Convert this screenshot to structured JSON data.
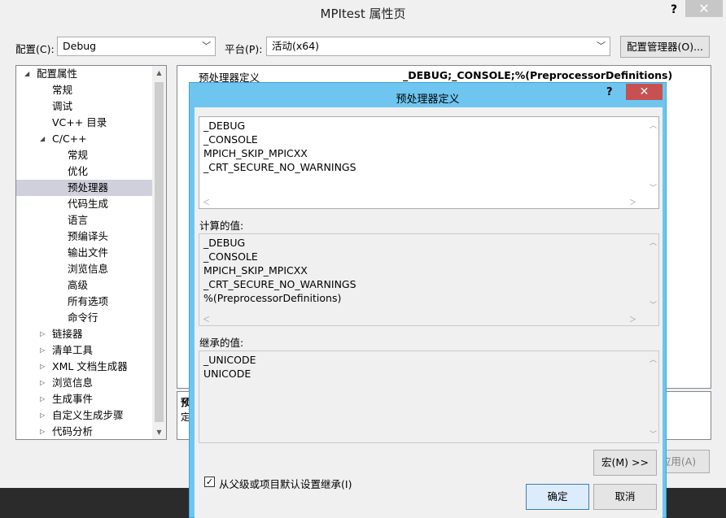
{
  "window": {
    "title": "MPItest 属性页",
    "help": "?",
    "close": "✕"
  },
  "toolbar": {
    "config_label": "配置(C):",
    "config_value": "Debug",
    "platform_label": "平台(P):",
    "platform_value": "活动(x64)",
    "config_manager": "配置管理器(O)..."
  },
  "tree": {
    "items": [
      {
        "label": "配置属性",
        "arrow": "◢"
      },
      {
        "label": "常规"
      },
      {
        "label": "调试"
      },
      {
        "label": "VC++ 目录"
      },
      {
        "label": "C/C++",
        "arrow": "◢"
      },
      {
        "label": "常规"
      },
      {
        "label": "优化"
      },
      {
        "label": "预处理器"
      },
      {
        "label": "代码生成"
      },
      {
        "label": "语言"
      },
      {
        "label": "预编译头"
      },
      {
        "label": "输出文件"
      },
      {
        "label": "浏览信息"
      },
      {
        "label": "高级"
      },
      {
        "label": "所有选项"
      },
      {
        "label": "命令行"
      },
      {
        "label": "链接器",
        "arrow": "▷"
      },
      {
        "label": "清单工具",
        "arrow": "▷"
      },
      {
        "label": "XML 文档生成器",
        "arrow": "▷"
      },
      {
        "label": "浏览信息",
        "arrow": "▷"
      },
      {
        "label": "生成事件",
        "arrow": "▷"
      },
      {
        "label": "自定义生成步骤",
        "arrow": "▷"
      },
      {
        "label": "代码分析",
        "arrow": "▷"
      }
    ]
  },
  "grid": {
    "row_name": "预处理器定义",
    "row_value": "_DEBUG;_CONSOLE;%(PreprocessorDefinitions)",
    "desc_title": "预",
    "desc_text": "定"
  },
  "apply_button": "应用(A)",
  "dialog": {
    "title": "预处理器定义",
    "help": "?",
    "close": "✕",
    "definitions": [
      "_DEBUG",
      "_CONSOLE",
      "MPICH_SKIP_MPICXX",
      "_CRT_SECURE_NO_WARNINGS"
    ],
    "evaluated_label": "计算的值:",
    "evaluated": [
      "_DEBUG",
      "_CONSOLE",
      "MPICH_SKIP_MPICXX",
      "_CRT_SECURE_NO_WARNINGS",
      "%(PreprocessorDefinitions)"
    ],
    "inherited_label": "继承的值:",
    "inherited": [
      "_UNICODE",
      "UNICODE"
    ],
    "inherit_checkbox_label": "从父级或项目默认设置继承(I)",
    "inherit_checked": true,
    "check_mark": "✓",
    "macro_button": "宏(M) >>",
    "ok_button": "确定",
    "cancel_button": "取消"
  }
}
